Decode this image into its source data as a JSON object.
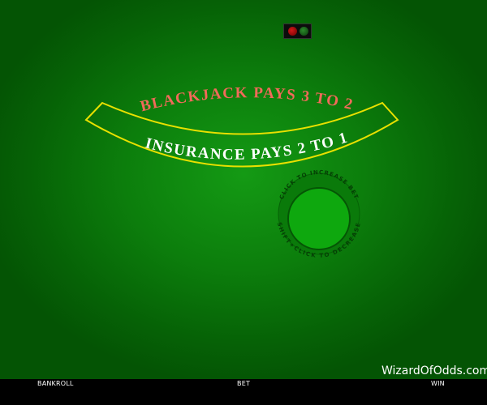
{
  "table": {
    "felt_color": "#0c7e0c",
    "arc_line_color": "#e8e000",
    "blackjack_text": "BLACKJACK PAYS 3 TO 2",
    "blackjack_text_color": "#f26a5a",
    "insurance_text": "INSURANCE PAYS 2 TO 1",
    "insurance_text_color": "#ffffff",
    "bet_circle_hint": "CLICK TO INCREASE BET",
    "bet_circle_hint_2": "SHIFT+CLICK TO DECREASE"
  },
  "indicator_lights": {
    "red_icon": "red-light-icon",
    "green_icon": "green-light-icon"
  },
  "bottom_bar": {
    "bankroll_label": "BANKROLL",
    "bet_label": "BET",
    "win_label": "WIN"
  },
  "watermark": {
    "text": "WizardOfOdds.com"
  }
}
